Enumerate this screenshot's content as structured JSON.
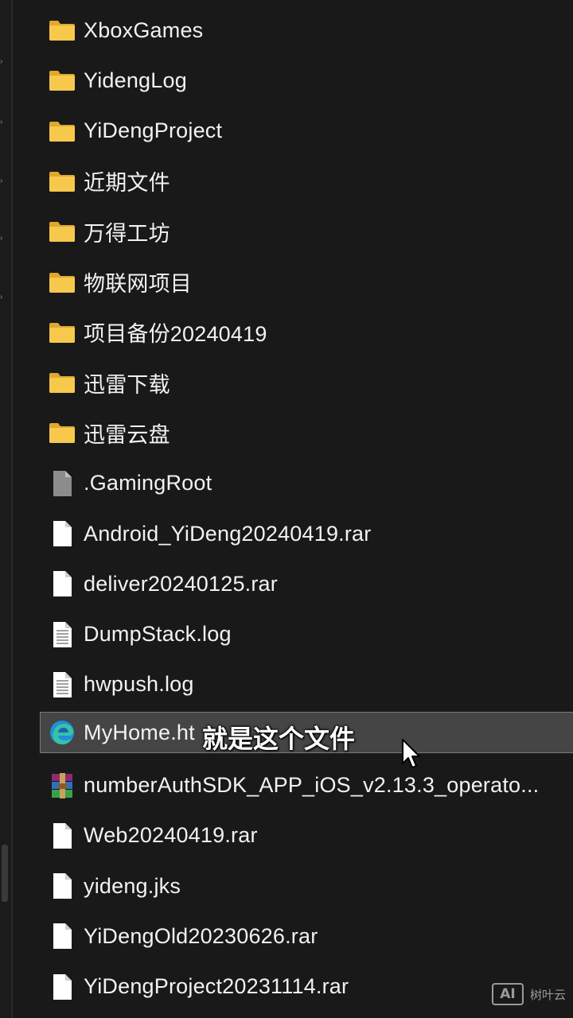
{
  "files": [
    {
      "name": "XboxGames",
      "type": "folder"
    },
    {
      "name": "YidengLog",
      "type": "folder"
    },
    {
      "name": "YiDengProject",
      "type": "folder"
    },
    {
      "name": "近期文件",
      "type": "folder"
    },
    {
      "name": "万得工坊",
      "type": "folder"
    },
    {
      "name": "物联网项目",
      "type": "folder"
    },
    {
      "name": "项目备份20240419",
      "type": "folder"
    },
    {
      "name": "迅雷下载",
      "type": "folder"
    },
    {
      "name": "迅雷云盘",
      "type": "folder"
    },
    {
      "name": ".GamingRoot",
      "type": "system-file"
    },
    {
      "name": "Android_YiDeng20240419.rar",
      "type": "file"
    },
    {
      "name": "deliver20240125.rar",
      "type": "file"
    },
    {
      "name": "DumpStack.log",
      "type": "text-file"
    },
    {
      "name": "hwpush.log",
      "type": "text-file"
    },
    {
      "name": "MyHome.ht",
      "type": "edge-html",
      "selected": true
    },
    {
      "name": "numberAuthSDK_APP_iOS_v2.13.3_operato...",
      "type": "rar-archive"
    },
    {
      "name": "Web20240419.rar",
      "type": "file"
    },
    {
      "name": "yideng.jks",
      "type": "file"
    },
    {
      "name": "YiDengOld20230626.rar",
      "type": "file"
    },
    {
      "name": "YiDengProject20231114.rar",
      "type": "file"
    }
  ],
  "caption": "就是这个文件",
  "watermark": {
    "logo": "AI",
    "text": "树叶云"
  },
  "colors": {
    "background": "#191919",
    "folder": "#f3c04a",
    "selection": "#454545",
    "text": "#f2f2f2"
  }
}
